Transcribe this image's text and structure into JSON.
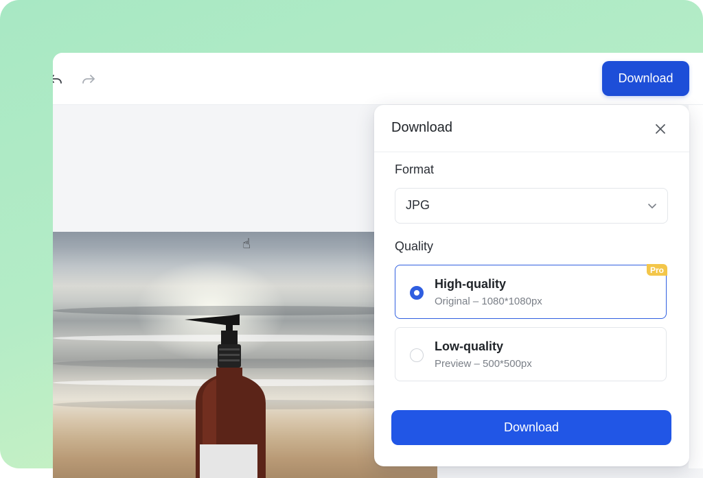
{
  "toolbar": {
    "undo_icon": "undo-icon",
    "redo_icon": "redo-icon",
    "download_label": "Download"
  },
  "panel": {
    "title": "Download",
    "close_icon": "close-icon",
    "format": {
      "label": "Format",
      "selected": "JPG",
      "chevron_icon": "chevron-down-icon"
    },
    "quality": {
      "label": "Quality",
      "options": [
        {
          "title": "High-quality",
          "subtitle": "Original – 1080*1080px",
          "selected": true,
          "badge": "Pro"
        },
        {
          "title": "Low-quality",
          "subtitle": "Preview – 500*500px",
          "selected": false
        }
      ]
    },
    "download_label": "Download"
  },
  "colors": {
    "primary": "#2156e6",
    "primary_dark": "#1d4ed8",
    "pro_badge": "#f3c64a",
    "background_gradient_start": "#a8e8c4",
    "background_gradient_end": "#def7c4"
  }
}
